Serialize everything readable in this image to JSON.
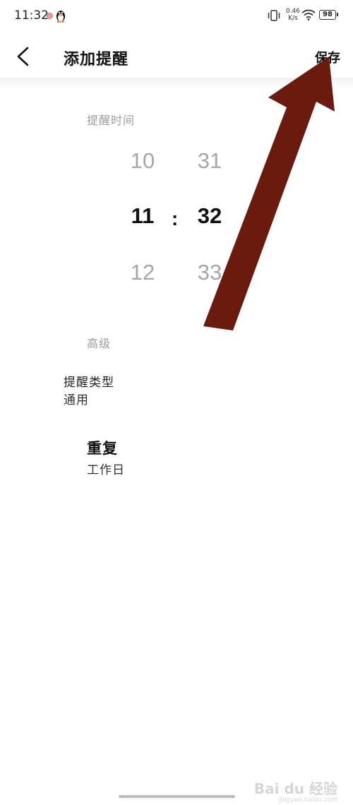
{
  "status_bar": {
    "time": "11:32",
    "net_speed_value": "0.46",
    "net_speed_unit": "K/s",
    "battery": "98",
    "icons": [
      "notification-dot-icon",
      "qq-penguin-icon",
      "vibrate-icon",
      "wifi-icon",
      "battery-icon"
    ]
  },
  "header": {
    "title": "添加提醒",
    "save_label": "保存",
    "back_icon": "chevron-left-icon"
  },
  "reminder_time": {
    "label": "提醒时间",
    "hours": [
      "10",
      "11",
      "12"
    ],
    "minutes": [
      "31",
      "32",
      "33"
    ],
    "selected_hour": "11",
    "selected_minute": "32",
    "separator": ":"
  },
  "advanced": {
    "label": "高级",
    "reminder_type": {
      "title": "提醒类型",
      "value": "通用"
    },
    "repeat": {
      "title": "重复",
      "value": "工作日"
    }
  },
  "annotation": {
    "arrow_color": "#6b1a0e",
    "arrow_points_to": "save-button"
  },
  "watermark": {
    "brand": "Bai du 经验",
    "url": "jingyan.baidu.com"
  },
  "colors": {
    "background": "#ffffff",
    "primary_text": "#111111",
    "secondary_text": "#9b9b9b",
    "unselected_wheel": "#a6a6a6"
  }
}
